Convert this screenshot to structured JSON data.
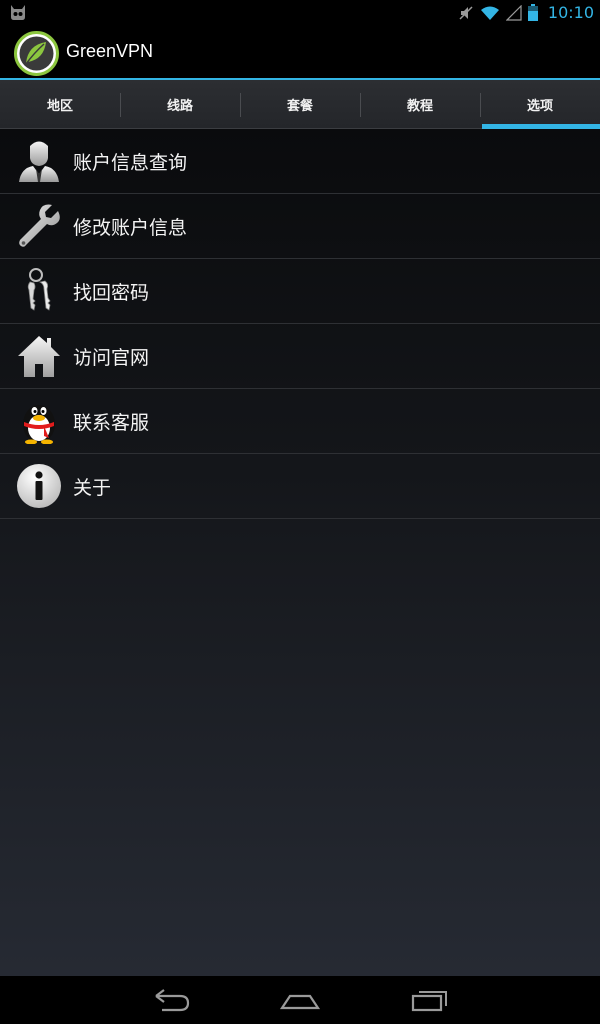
{
  "status_bar": {
    "clock": "10:10",
    "icons": [
      "cyanogen-icon",
      "mute-icon",
      "wifi-icon",
      "signal-icon",
      "battery-icon"
    ]
  },
  "app": {
    "title": "GreenVPN",
    "logo_icon": "green-leaf-logo",
    "accent_color": "#33b5e5"
  },
  "tabs": [
    {
      "label": "地区",
      "active": false
    },
    {
      "label": "线路",
      "active": false
    },
    {
      "label": "套餐",
      "active": false
    },
    {
      "label": "教程",
      "active": false
    },
    {
      "label": "选项",
      "active": true
    }
  ],
  "menu": [
    {
      "label": "账户信息查询",
      "icon": "user-icon"
    },
    {
      "label": "修改账户信息",
      "icon": "wrench-icon"
    },
    {
      "label": "找回密码",
      "icon": "keys-icon"
    },
    {
      "label": "访问官网",
      "icon": "home-icon"
    },
    {
      "label": "联系客服",
      "icon": "qq-penguin-icon"
    },
    {
      "label": "关于",
      "icon": "info-icon"
    }
  ],
  "nav_bar": {
    "icons": [
      "back-icon",
      "home-nav-icon",
      "recent-apps-icon"
    ]
  }
}
